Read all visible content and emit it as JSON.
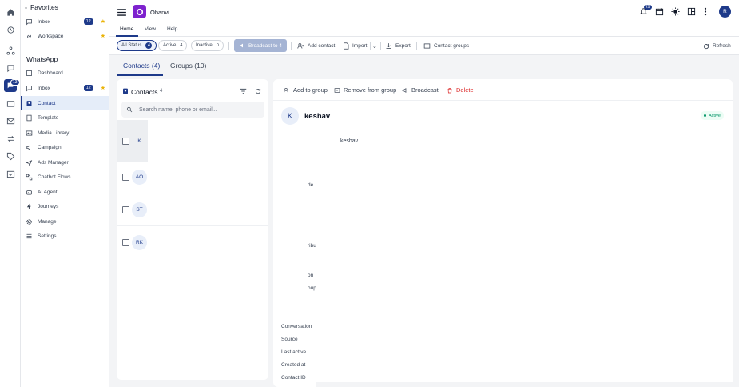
{
  "app": {
    "name": "Ohanvi",
    "avatar": "R",
    "notif_count": "29"
  },
  "rail": {
    "badge": "13"
  },
  "sidebar": {
    "favorites_label": "Favorites",
    "favorites": [
      {
        "label": "Inbox",
        "badge": "12"
      },
      {
        "label": "Workspace"
      }
    ],
    "section": "WhatsApp",
    "items": [
      {
        "label": "Dashboard"
      },
      {
        "label": "Inbox",
        "badge": "12"
      },
      {
        "label": "Contact"
      },
      {
        "label": "Template"
      },
      {
        "label": "Media Library"
      },
      {
        "label": "Campaign"
      },
      {
        "label": "Ads Manager"
      },
      {
        "label": "Chatbot Flows"
      },
      {
        "label": "AI Agent"
      },
      {
        "label": "Journeys"
      },
      {
        "label": "Manage"
      },
      {
        "label": "Settings"
      }
    ]
  },
  "ribbon_tabs": [
    "Home",
    "View",
    "Help"
  ],
  "toolbar": {
    "filters": [
      {
        "label": "All Status",
        "count": "4"
      },
      {
        "label": "Active",
        "count": "4"
      },
      {
        "label": "Inactive",
        "count": "0"
      }
    ],
    "broadcast": "Broadcast to 4",
    "add_contact": "Add contact",
    "import": "Import",
    "export": "Export",
    "contact_groups": "Contact groups",
    "refresh": "Refresh"
  },
  "tabs": {
    "contacts": "Contacts (4)",
    "groups": "Groups (10)"
  },
  "list": {
    "title": "Contacts",
    "count": "4",
    "search_placeholder": "Search name, phone or email...",
    "rows": [
      {
        "initials": "K"
      },
      {
        "initials": "AO"
      },
      {
        "initials": "ST"
      },
      {
        "initials": "RK"
      }
    ]
  },
  "detail": {
    "actions": {
      "add_to_group": "Add to group",
      "remove_from_group": "Remove from group",
      "broadcast": "Broadcast",
      "delete": "Delete"
    },
    "initial": "K",
    "name": "keshav",
    "status": "Active",
    "name_value": "keshav",
    "fragments": [
      "de",
      "ribu",
      "on",
      "oup"
    ],
    "fields": [
      "Conversation",
      "Source",
      "Last active",
      "Created at",
      "Contact ID"
    ]
  }
}
